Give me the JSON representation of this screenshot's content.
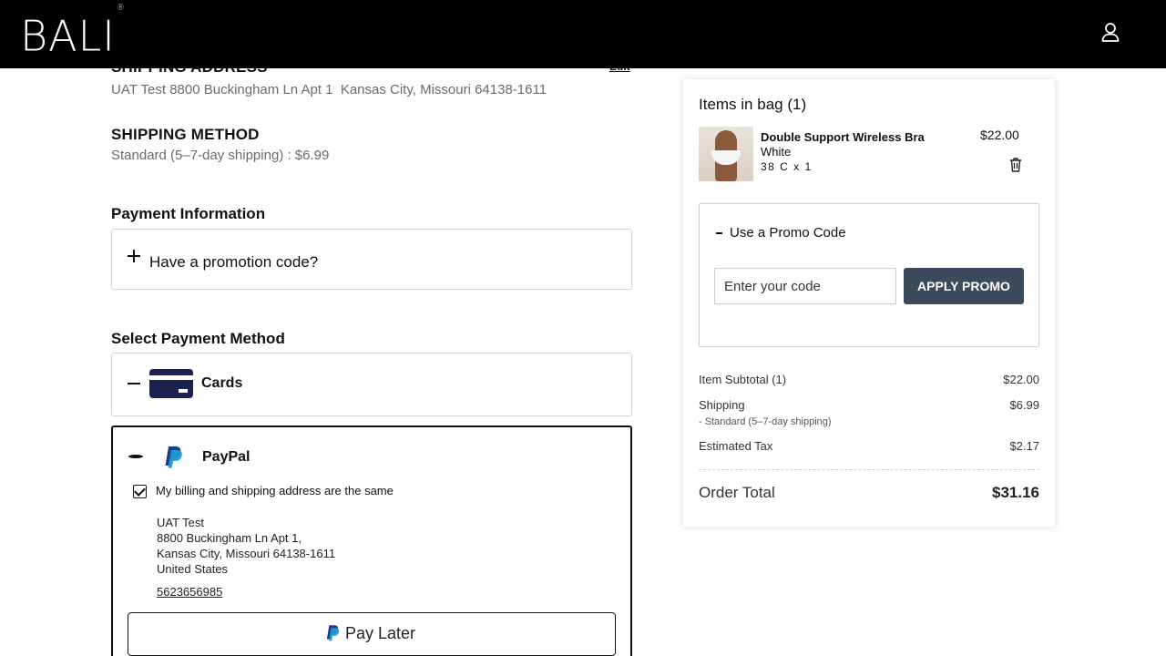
{
  "header": {
    "logo_text": "BALI",
    "logo_mark": "®",
    "account_icon": "user-icon"
  },
  "shipping_address": {
    "heading": "SHIPPING ADDRESS",
    "edit_label": "Edit",
    "value": "UAT Test 8800 Buckingham Ln Apt 1  Kansas City, Missouri 64138-1611"
  },
  "shipping_method": {
    "heading": "SHIPPING METHOD",
    "value": "Standard (5–7-day shipping) : $6.99"
  },
  "payment_information": {
    "heading": "Payment Information",
    "promo_toggle_label": "Have a promotion code?"
  },
  "payment_methods": {
    "heading": "Select Payment Method",
    "cards_label": "Cards",
    "paypal_label": "PayPal",
    "same_address_label": "My billing and shipping address are the same",
    "same_address_checked": true,
    "billing_address": {
      "name": "UAT Test",
      "line1": "8800 Buckingham Ln Apt 1,",
      "city_line": "Kansas City, Missouri 64138-1611",
      "country": "United States",
      "phone": "5623656985"
    },
    "pay_later_label": "Pay Later"
  },
  "summary": {
    "bag_heading": "Items in bag (1)",
    "item": {
      "name": "Double Support Wireless Bra",
      "color": "White",
      "size_qty": "38 C x 1",
      "price": "$22.00"
    },
    "promo": {
      "title": "Use a Promo Code",
      "input_placeholder": "Enter your code",
      "apply_label": "APPLY PROMO"
    },
    "subtotal_label": "Item Subtotal (1)",
    "subtotal_value": "$22.00",
    "shipping_label": "Shipping",
    "shipping_value": "$6.99",
    "shipping_note": "- Standard (5–7-day shipping)",
    "tax_label": "Estimated Tax",
    "tax_value": "$2.17",
    "total_label": "Order Total",
    "total_value": "$31.16"
  }
}
